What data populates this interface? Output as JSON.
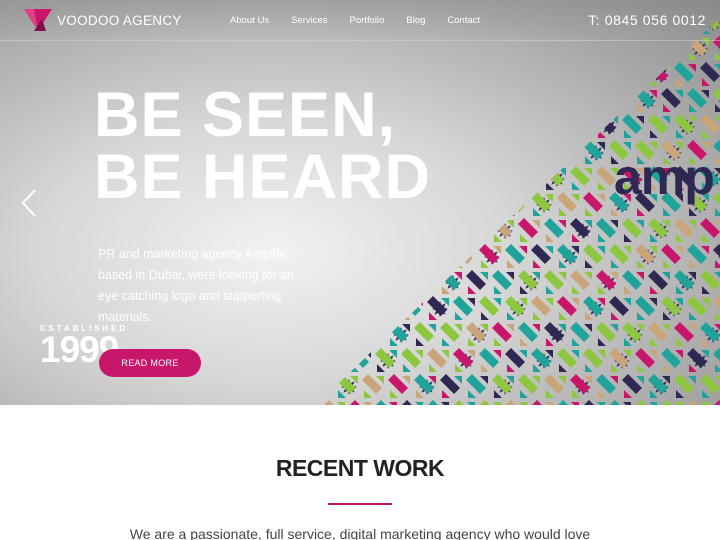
{
  "brand": {
    "name": "VOODOO AGENCY",
    "accent_color": "#c8166b",
    "logo_icon": "voodoo-triangle-logo"
  },
  "nav": {
    "items": [
      {
        "label": "About Us"
      },
      {
        "label": "Services"
      },
      {
        "label": "Portfolio"
      },
      {
        "label": "Blog"
      },
      {
        "label": "Contact"
      }
    ],
    "phone": "T: 0845 056 0012"
  },
  "hero": {
    "headline_line1": "BE SEEN,",
    "headline_line2": "BE HEARD",
    "body": "PR and marketing agency Amplify, based in Dubai, were looking for an eye catching logo and supporting materials.",
    "established_label": "ESTABLISHED",
    "established_year": "1999",
    "cta_label": "READ MORE",
    "prev_icon": "chevron-left-icon",
    "client_logo_text": "amp"
  },
  "recent_work": {
    "title": "RECENT WORK",
    "intro": "We are a passionate, full service, digital marketing agency who would love"
  }
}
